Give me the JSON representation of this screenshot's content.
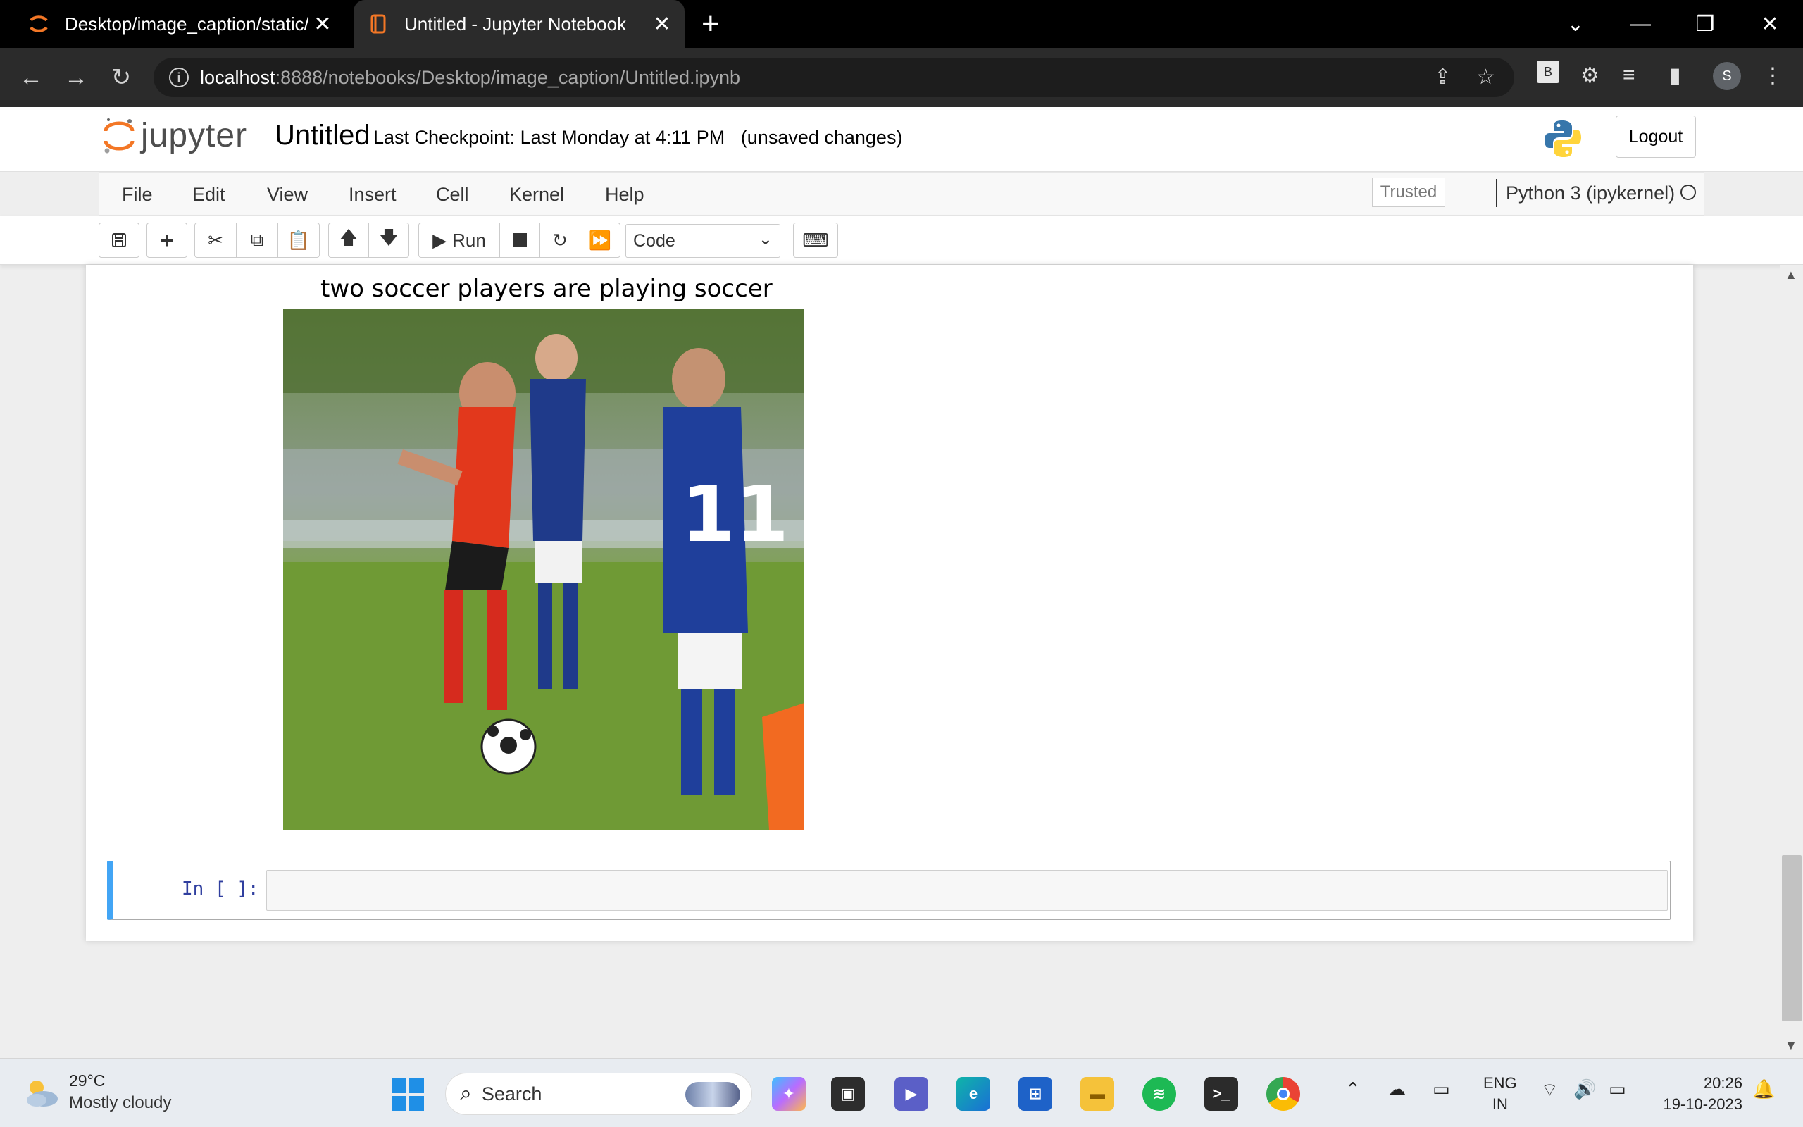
{
  "browser": {
    "tabs": [
      {
        "title": "Desktop/image_caption/static/",
        "active": false
      },
      {
        "title": "Untitled - Jupyter Notebook",
        "active": true
      }
    ],
    "url_host": "localhost",
    "url_rest": ":8888/notebooks/Desktop/image_caption/Untitled.ipynb",
    "profile_initial": "S",
    "extension_badge": "B"
  },
  "jupyter": {
    "logo_text": "jupyter",
    "notebook_title": "Untitled",
    "checkpoint": "Last Checkpoint: Last Monday at 4:11 PM",
    "status": "(unsaved changes)",
    "logout_label": "Logout",
    "menu": [
      "File",
      "Edit",
      "View",
      "Insert",
      "Cell",
      "Kernel",
      "Help"
    ],
    "trusted_label": "Trusted",
    "kernel_name": "Python 3 (ipykernel)",
    "toolbar": {
      "run_label": "Run",
      "cell_type": "Code"
    }
  },
  "output": {
    "caption": "two soccer players are playing soccer"
  },
  "cell": {
    "prompt": "In [ ]:"
  },
  "taskbar": {
    "temperature": "29°C",
    "weather": "Mostly cloudy",
    "search_placeholder": "Search",
    "lang_line1": "ENG",
    "lang_line2": "IN",
    "time": "20:26",
    "date": "19-10-2023"
  }
}
